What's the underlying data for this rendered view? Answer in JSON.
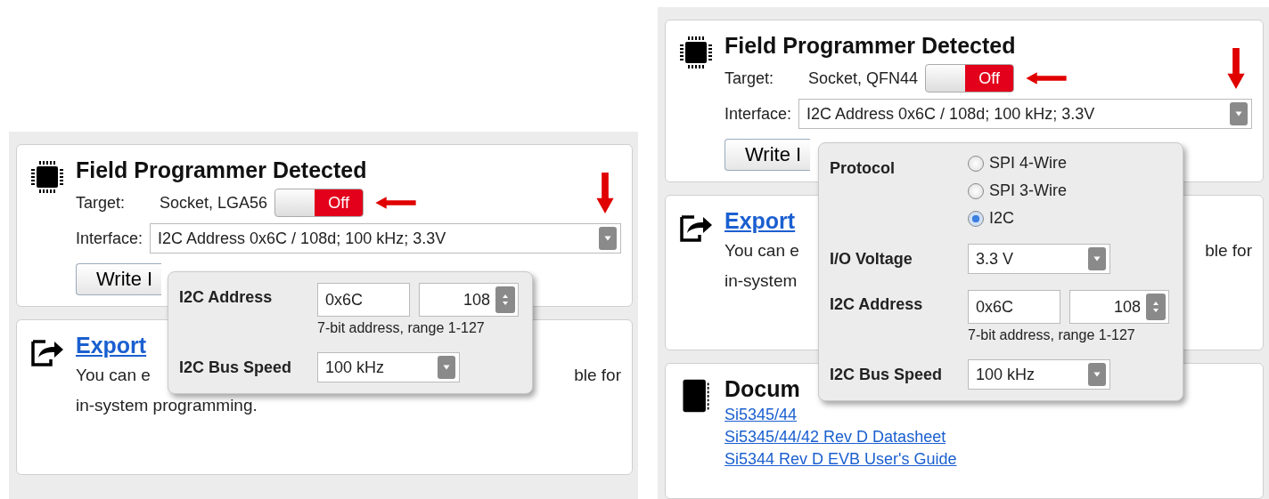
{
  "panels": [
    {
      "title": "Field Programmer Detected",
      "target_label": "Target:",
      "target_value": "Socket, LGA56",
      "power_switch": {
        "label": "Off",
        "on": false
      },
      "interface_label": "Interface:",
      "interface_value": "I2C Address 0x6C / 108d; 100 kHz; 3.3V",
      "write_button": "Write I",
      "export": {
        "title": "Export",
        "lines": [
          {
            "left": "You can e",
            "right": "ble for"
          },
          {
            "left": "in-system programming."
          }
        ]
      },
      "popup": {
        "rows": [
          {
            "kind": "address",
            "label": "I2C Address",
            "hex": "0x6C",
            "decimal": "108",
            "hint": "7-bit address, range 1-127"
          },
          {
            "kind": "select",
            "label": "I2C Bus Speed",
            "value": "100 kHz"
          }
        ]
      }
    },
    {
      "title": "Field Programmer Detected",
      "target_label": "Target:",
      "target_value": "Socket, QFN44",
      "power_switch": {
        "label": "Off",
        "on": false
      },
      "interface_label": "Interface:",
      "interface_value": "I2C Address 0x6C / 108d; 100 kHz; 3.3V",
      "write_button": "Write I",
      "export": {
        "title": "Export",
        "lines": [
          {
            "left": "You can e",
            "right": "ble for"
          },
          {
            "left": "in-system"
          }
        ]
      },
      "documents": {
        "title": "Docum",
        "links": [
          "Si5345/44",
          "Si5345/44/42 Rev D Datasheet",
          "Si5344 Rev D EVB User's Guide"
        ]
      },
      "popup": {
        "rows": [
          {
            "kind": "radio-group",
            "label": "Protocol",
            "options": [
              {
                "label": "SPI 4-Wire",
                "selected": false
              },
              {
                "label": "SPI 3-Wire",
                "selected": false
              },
              {
                "label": "I2C",
                "selected": true
              }
            ]
          },
          {
            "kind": "select",
            "label": "I/O Voltage",
            "value": "3.3 V"
          },
          {
            "kind": "address",
            "label": "I2C Address",
            "hex": "0x6C",
            "decimal": "108",
            "hint": "7-bit address, range 1-127"
          },
          {
            "kind": "select",
            "label": "I2C Bus Speed",
            "value": "100 kHz"
          }
        ]
      }
    }
  ]
}
